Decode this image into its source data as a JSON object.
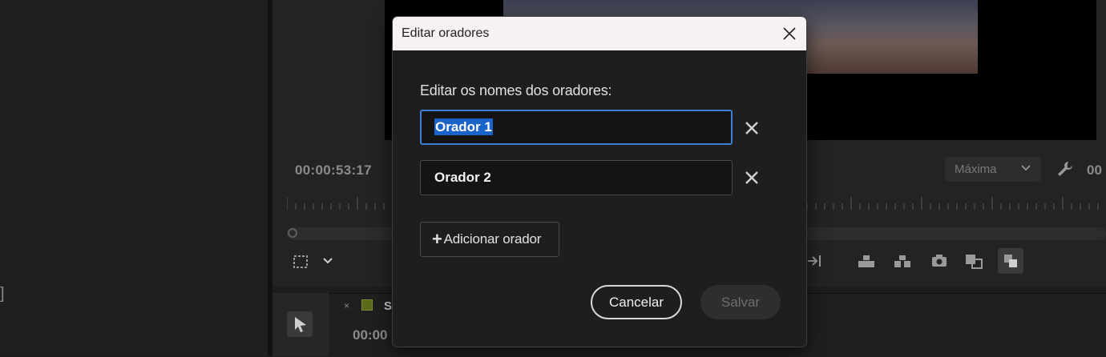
{
  "monitor": {
    "timecode": "00:00:53:17",
    "quality": "Máxima",
    "right_timecode": "00"
  },
  "timeline": {
    "sequence_tab_label": "S",
    "sequence_close": "×",
    "sequence_time": "00:00"
  },
  "left_panel": {
    "bracket": "]"
  },
  "dialog": {
    "title": "Editar oradores",
    "prompt": "Editar os nomes dos oradores:",
    "speakers": [
      {
        "value": "Orador 1",
        "selected": true
      },
      {
        "value": "Orador 2",
        "selected": false
      }
    ],
    "add_button_label": "Adicionar orador",
    "cancel_label": "Cancelar",
    "save_label": "Salvar",
    "save_enabled": false
  },
  "colors": {
    "accent": "#3b82d6",
    "selection": "#1a63c8",
    "titlebar": "#f7f1f1"
  }
}
